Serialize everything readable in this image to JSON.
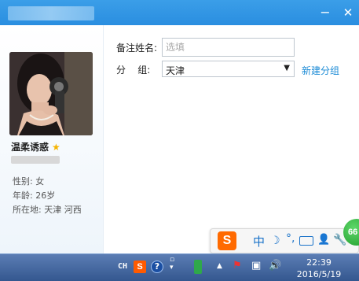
{
  "window": {
    "minimize_glyph": "−",
    "close_glyph": "✕"
  },
  "profile": {
    "name": "温柔诱惑",
    "star_glyph": "★",
    "gender": "性别: 女",
    "age": "年龄: 26岁",
    "location": "所在地: 天津  河西"
  },
  "form": {
    "remark_label": "备注姓名:",
    "remark_placeholder": "选填",
    "group_label": "分    组:",
    "group_value": "天津",
    "new_group_link": "新建分组"
  },
  "ime": {
    "logo": "S",
    "mode": "中",
    "half_width_glyph": "☽",
    "punct_glyph": "°,",
    "user_glyph": "👤",
    "tool_glyph": "🔧"
  },
  "badge": {
    "count": "66"
  },
  "taskbar": {
    "lang": "CH",
    "sogou": "S",
    "help": "?",
    "clock_time": "22:39",
    "clock_date": "2016/5/19"
  }
}
